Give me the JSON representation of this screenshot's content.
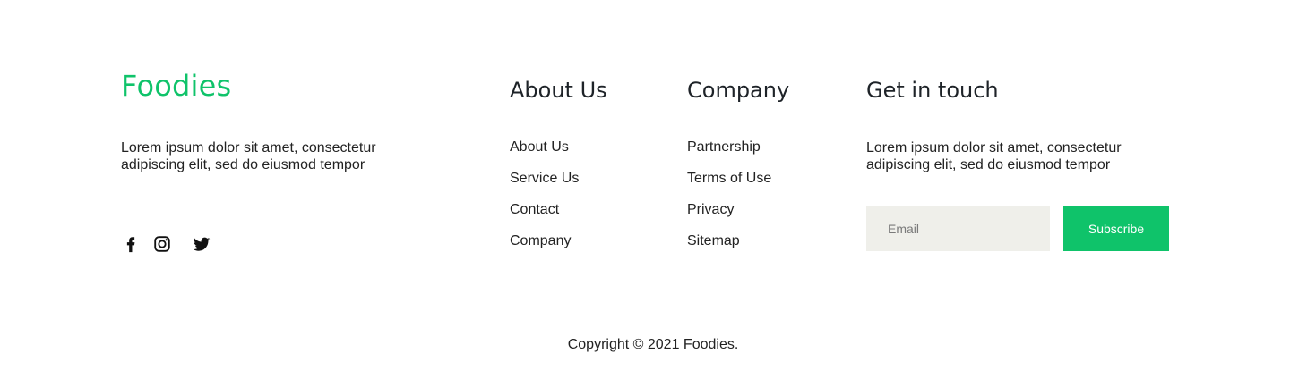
{
  "brand": {
    "name": "Foodies",
    "color": "#0fc36a",
    "description": "Lorem ipsum dolor sit amet, consectetur adipiscing elit, sed do eiusmod tempor"
  },
  "social": [
    {
      "icon": "facebook-icon"
    },
    {
      "icon": "instagram-icon"
    },
    {
      "icon": "twitter-icon"
    }
  ],
  "about": {
    "title": "About Us",
    "items": [
      "About Us",
      "Service Us",
      "Contact",
      "Company"
    ]
  },
  "company": {
    "title": "Company",
    "items": [
      "Partnership",
      "Terms of Use",
      "Privacy",
      "Sitemap"
    ]
  },
  "touch": {
    "title": "Get in touch",
    "description": "Lorem ipsum dolor sit amet, consectetur adipiscing elit, sed do eiusmod tempor",
    "email_placeholder": "Email",
    "subscribe_label": "Subscribe"
  },
  "copyright": "Copyright © 2021 Foodies."
}
